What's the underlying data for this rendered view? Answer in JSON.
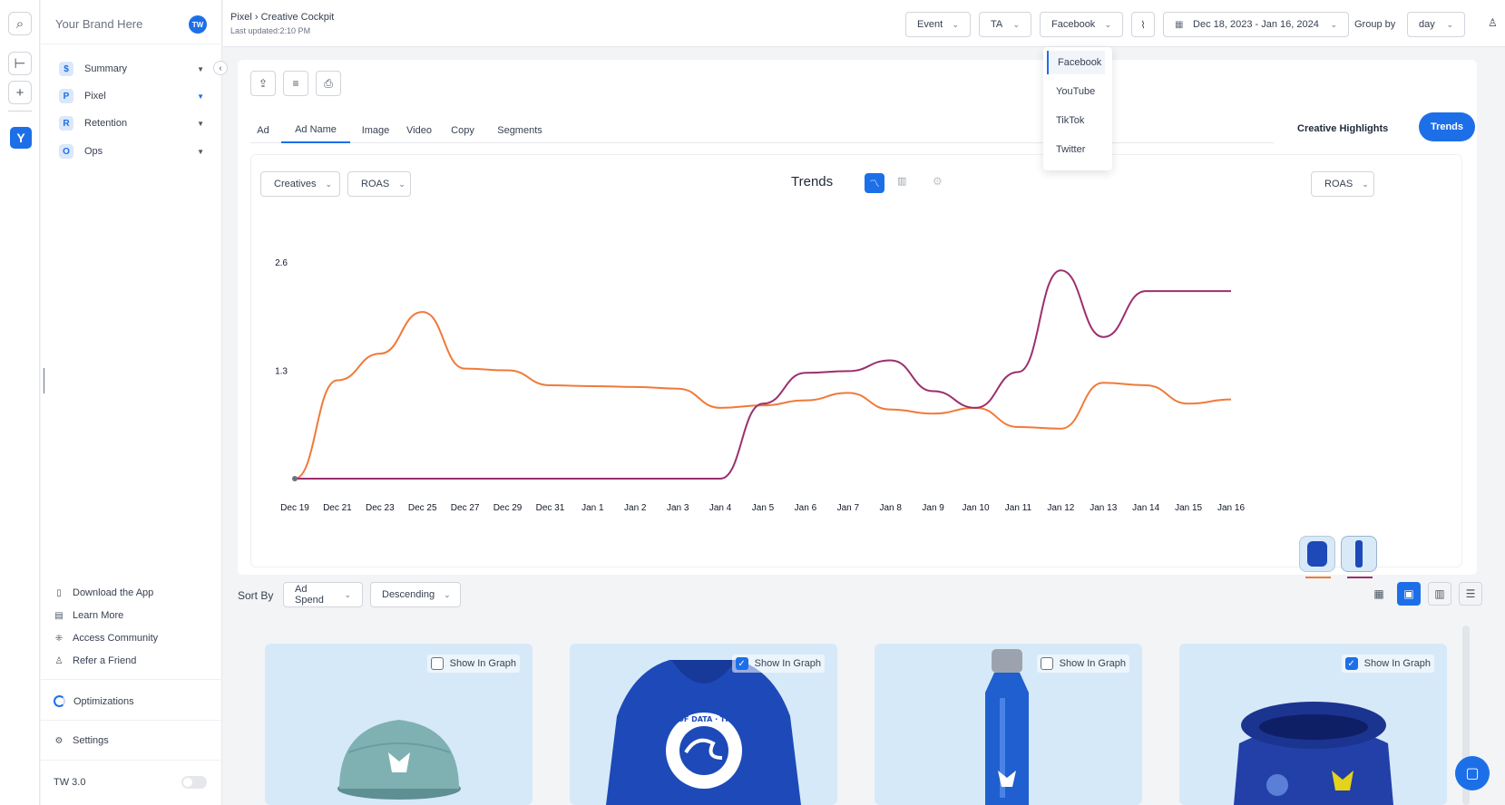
{
  "brand": {
    "name": "Your Brand Here",
    "avatar": "TW"
  },
  "nav": [
    {
      "label": "Summary",
      "icon": "$"
    },
    {
      "label": "Pixel",
      "icon": "P"
    },
    {
      "label": "Retention",
      "icon": "R"
    },
    {
      "label": "Ops",
      "icon": "O"
    }
  ],
  "footer": {
    "download": "Download the App",
    "learn": "Learn More",
    "community": "Access Community",
    "refer": "Refer a Friend",
    "optimizations": "Optimizations",
    "settings": "Settings",
    "version": "TW 3.0"
  },
  "header": {
    "breadcrumb": "Pixel  ›  Creative Cockpit",
    "updated": "Last updated:2:10 PM",
    "event": "Event",
    "ta": "TA",
    "platform": "Facebook",
    "date_range": "Dec 18, 2023 - Jan 16, 2024",
    "group_by_label": "Group by",
    "group_by": "day"
  },
  "platform_options": [
    "Facebook",
    "YouTube",
    "TikTok",
    "Twitter"
  ],
  "tabs": [
    "Ad",
    "Ad Name",
    "Image",
    "Video",
    "Copy",
    "Segments"
  ],
  "active_tab": "Ad Name",
  "creative_highlights": "Creative Highlights",
  "trends_button": "Trends",
  "chart_controls": {
    "left1": "Creatives",
    "left2": "ROAS",
    "title": "Trends",
    "right": "ROAS"
  },
  "chart_data": {
    "type": "line",
    "x": [
      "Dec 19",
      "Dec 21",
      "Dec 23",
      "Dec 25",
      "Dec 27",
      "Dec 29",
      "Dec 31",
      "Jan 1",
      "Jan 2",
      "Jan 3",
      "Jan 4",
      "Jan 5",
      "Jan 6",
      "Jan 7",
      "Jan 8",
      "Jan 9",
      "Jan 10",
      "Jan 11",
      "Jan 12",
      "Jan 13",
      "Jan 14",
      "Jan 15",
      "Jan 16"
    ],
    "y_ticks": [
      2.6,
      1.3
    ],
    "ylim": [
      0,
      2.6
    ],
    "series": [
      {
        "color": "#f07a3a",
        "values": [
          0,
          1.18,
          1.5,
          2.0,
          1.32,
          1.3,
          1.12,
          1.11,
          1.1,
          1.08,
          0.85,
          0.88,
          0.94,
          1.03,
          0.83,
          0.78,
          0.85,
          0.62,
          0.6,
          1.15,
          1.12,
          0.9,
          0.95
        ]
      },
      {
        "color": "#9b2f6e",
        "values": [
          0,
          0,
          0,
          0,
          0,
          0,
          0,
          0,
          0,
          0,
          0,
          0.9,
          1.27,
          1.29,
          1.42,
          1.05,
          0.85,
          1.28,
          2.5,
          1.7,
          2.25,
          2.25,
          2.25
        ]
      }
    ]
  },
  "sort": {
    "label": "Sort By",
    "field": "Ad Spend",
    "order": "Descending"
  },
  "cards": [
    {
      "label": "Show In Graph",
      "checked": false,
      "product": "cap"
    },
    {
      "label": "Show In Graph",
      "checked": true,
      "product": "hoodie"
    },
    {
      "label": "Show In Graph",
      "checked": false,
      "product": "bottle"
    },
    {
      "label": "Show In Graph",
      "checked": true,
      "product": "bag"
    }
  ],
  "hoodie_text": "A VAST SEA OF DATA · TRIPLE WHALE"
}
